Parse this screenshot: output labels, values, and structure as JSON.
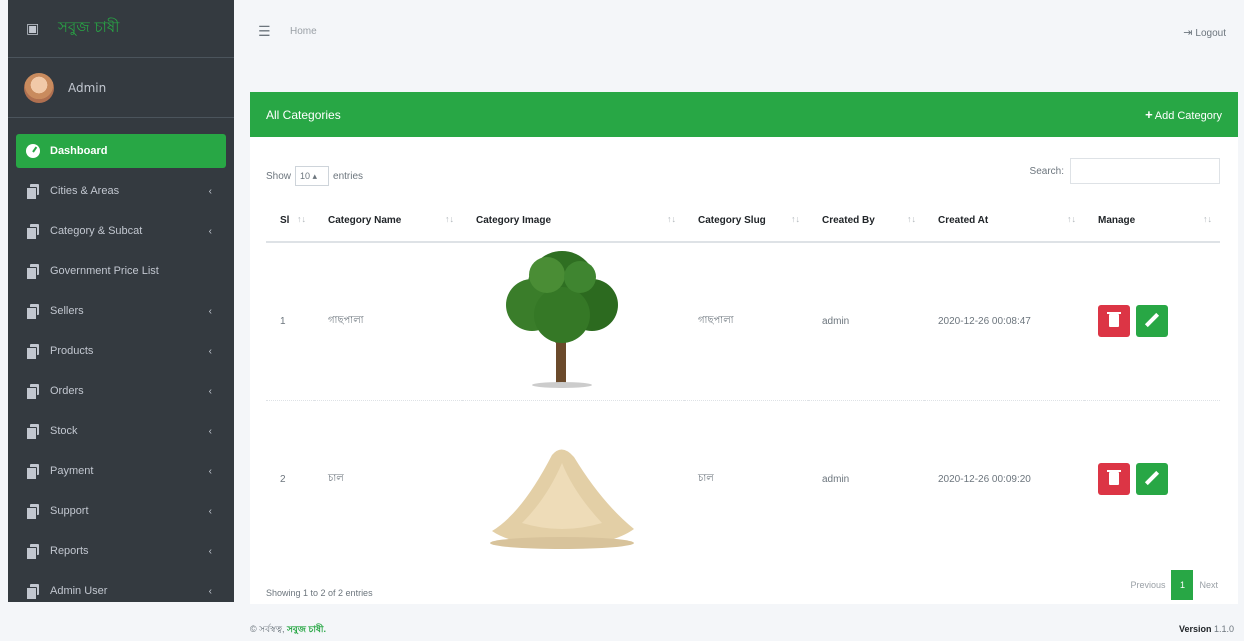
{
  "brand": {
    "name": "সবুজ চাষী",
    "icon": "logo-icon"
  },
  "user": {
    "name": "Admin"
  },
  "sidebar": {
    "items": [
      {
        "label": "Dashboard",
        "icon": "dashboard-icon",
        "active": true
      },
      {
        "label": "Cities & Areas",
        "icon": "copy-icon"
      },
      {
        "label": "Category & Subcat",
        "icon": "copy-icon"
      },
      {
        "label": "Government Price List",
        "icon": "copy-icon"
      },
      {
        "label": "Sellers",
        "icon": "copy-icon"
      },
      {
        "label": "Products",
        "icon": "copy-icon"
      },
      {
        "label": "Orders",
        "icon": "copy-icon"
      },
      {
        "label": "Stock",
        "icon": "copy-icon"
      },
      {
        "label": "Payment",
        "icon": "copy-icon"
      },
      {
        "label": "Support",
        "icon": "copy-icon"
      },
      {
        "label": "Reports",
        "icon": "copy-icon"
      },
      {
        "label": "Admin User",
        "icon": "copy-icon"
      }
    ]
  },
  "topbar": {
    "home": "Home",
    "logout": "Logout"
  },
  "card": {
    "title": "All Categories",
    "add_button": "Add Category",
    "show_label": "Show",
    "entries_value": "10",
    "entries_label": "entries",
    "search_label": "Search:",
    "columns": [
      "Sl",
      "Category Name",
      "Category Image",
      "Category Slug",
      "Created By",
      "Created At",
      "Manage"
    ],
    "rows": [
      {
        "sl": "1",
        "name": "গাছপালা",
        "image": "tree-image",
        "slug": "গাছপালা",
        "created_by": "admin",
        "created_at": "2020-12-26 00:08:47"
      },
      {
        "sl": "2",
        "name": "চাল",
        "image": "rice-image",
        "slug": "চাল",
        "created_by": "admin",
        "created_at": "2020-12-26 00:09:20"
      }
    ],
    "info": "Showing 1 to 2 of 2 entries",
    "pager": {
      "previous": "Previous",
      "page": "1",
      "next": "Next"
    }
  },
  "footer": {
    "prefix": "© সর্বস্বত্ব, ",
    "brand": "সবুজ চাষী.",
    "version_label": "Version",
    "version": "1.1.0"
  },
  "colors": {
    "primary": "#28a745",
    "danger": "#dc3545",
    "sidebar": "#343a40"
  }
}
